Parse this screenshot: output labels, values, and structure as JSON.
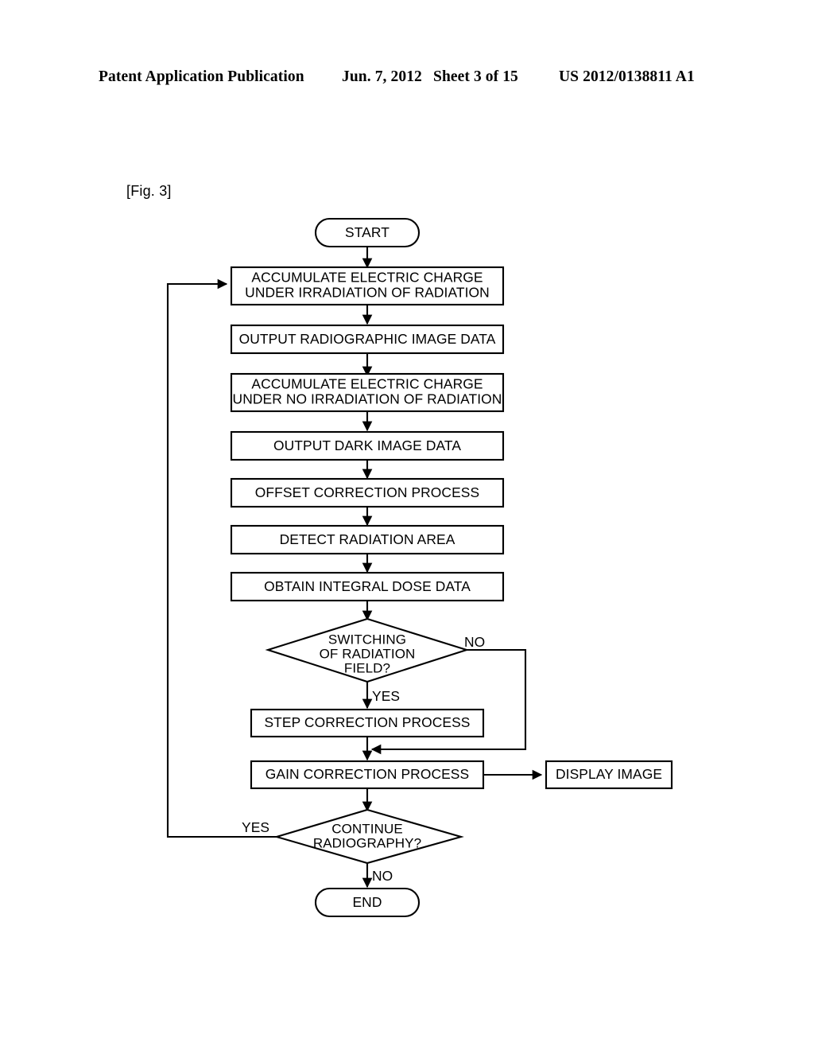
{
  "header": {
    "publication": "Patent Application Publication",
    "date": "Jun. 7, 2012",
    "sheet": "Sheet 3 of 15",
    "number": "US 2012/0138811 A1"
  },
  "figure": {
    "label": "[Fig. 3]"
  },
  "flowchart": {
    "nodes": {
      "start": {
        "label": "START",
        "shape": "terminal"
      },
      "accumulate_irradiation": {
        "line1": "ACCUMULATE ELECTRIC CHARGE",
        "line2": "UNDER IRRADIATION OF RADIATION",
        "shape": "process"
      },
      "output_radiographic": {
        "label": "OUTPUT RADIOGRAPHIC IMAGE DATA",
        "shape": "process"
      },
      "accumulate_no_irradiation": {
        "line1": "ACCUMULATE ELECTRIC CHARGE",
        "line2": "UNDER NO IRRADIATION OF RADIATION",
        "shape": "process"
      },
      "output_dark": {
        "label": "OUTPUT DARK IMAGE DATA",
        "shape": "process"
      },
      "offset_correction": {
        "label": "OFFSET CORRECTION PROCESS",
        "shape": "process"
      },
      "detect_radiation_area": {
        "label": "DETECT RADIATION AREA",
        "shape": "process"
      },
      "obtain_integral_dose": {
        "label": "OBTAIN INTEGRAL DOSE DATA",
        "shape": "process"
      },
      "switching_decision": {
        "line1": "SWITCHING",
        "line2": "OF RADIATION",
        "line3": "FIELD?",
        "shape": "decision"
      },
      "step_correction": {
        "label": "STEP CORRECTION PROCESS",
        "shape": "process"
      },
      "gain_correction": {
        "label": "GAIN CORRECTION PROCESS",
        "shape": "process"
      },
      "display_image": {
        "label": "DISPLAY IMAGE",
        "shape": "process"
      },
      "continue_decision": {
        "line1": "CONTINUE",
        "line2": "RADIOGRAPHY?",
        "shape": "decision"
      },
      "end": {
        "label": "END",
        "shape": "terminal"
      }
    },
    "edge_labels": {
      "switching_no": "NO",
      "switching_yes": "YES",
      "continue_yes": "YES",
      "continue_no": "NO"
    }
  }
}
